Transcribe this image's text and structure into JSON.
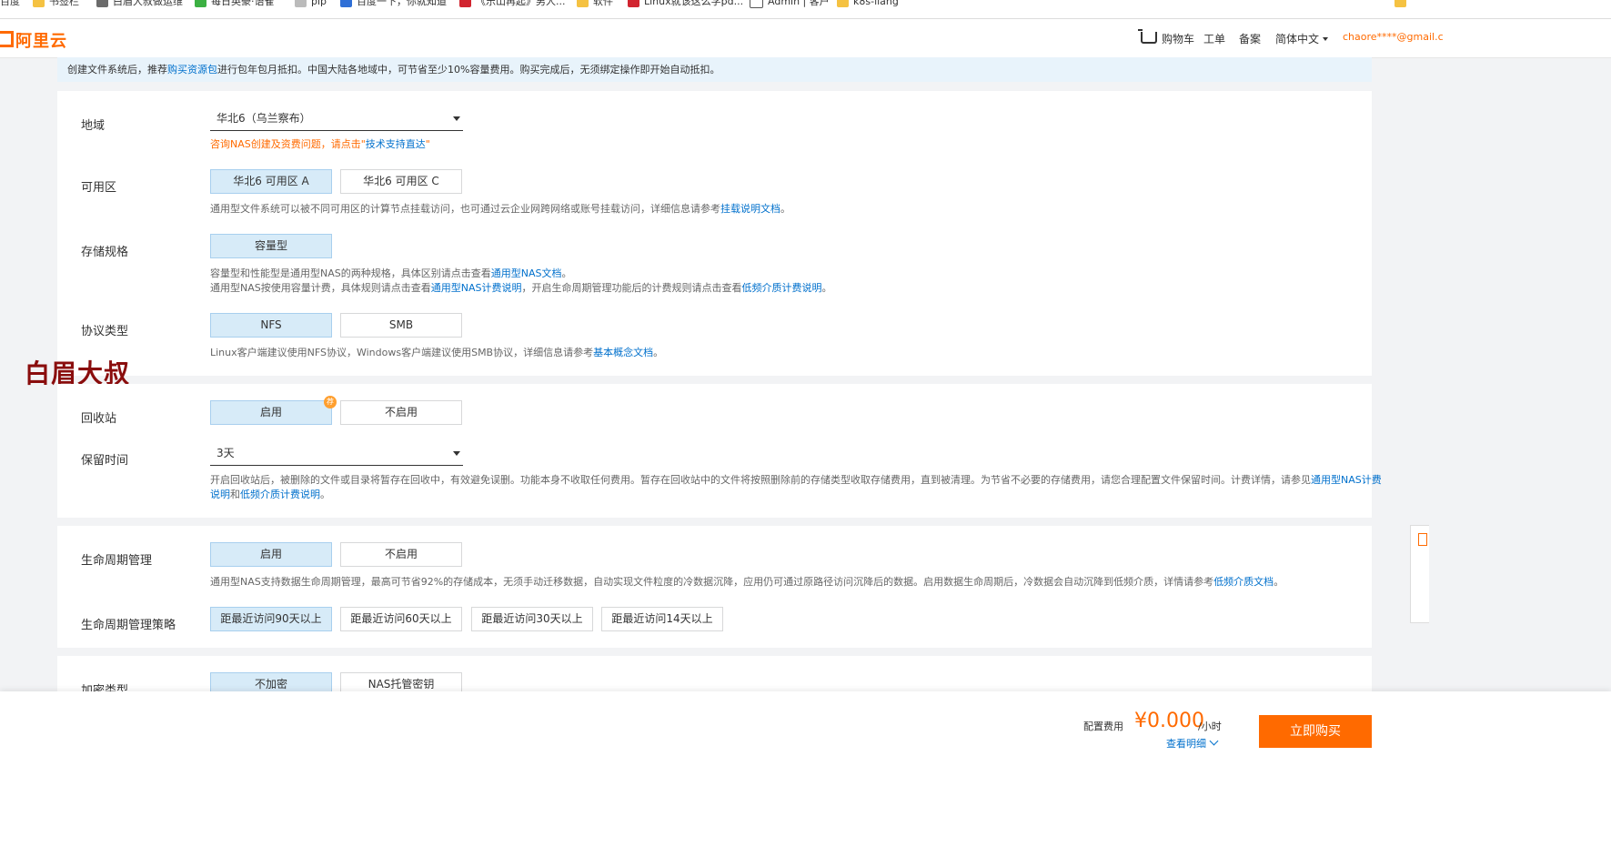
{
  "bookmarks": [
    {
      "label": "百度",
      "icon": "none-icon"
    },
    {
      "label": "书签栏",
      "icon": "folder-icon"
    },
    {
      "label": "白眉大叔做运维",
      "icon": "user-icon"
    },
    {
      "label": "每日英豪·语雀",
      "icon": "leaf-icon"
    },
    {
      "label": "pip",
      "icon": "package-icon"
    },
    {
      "label": "百度一下，你就知道",
      "icon": "paw-icon"
    },
    {
      "label": "《乐山再起》男人...",
      "icon": "video-icon"
    },
    {
      "label": "软件",
      "icon": "folder-icon"
    },
    {
      "label": "Linux就该这么学pd...",
      "icon": "red-icon"
    },
    {
      "label": "Admin | 客户",
      "icon": "doc-icon"
    },
    {
      "label": "k8s-liang",
      "icon": "folder-icon"
    }
  ],
  "header": {
    "logo_text": "阿里云",
    "cart": "购物车",
    "ticket": "工单",
    "record": "备案",
    "language": "简体中文",
    "user": "chaore****@gmail.c"
  },
  "notice": {
    "prefix": "创建文件系统后，推荐",
    "link": "购买资源包",
    "suffix": "进行包年包月抵扣。中国大陆各地域中，可节省至少10%容量费用。购买完成后，无须绑定操作即开始自动抵扣。"
  },
  "region": {
    "label": "地域",
    "value": "华北6（乌兰察布）",
    "hint_prefix": "咨询NAS创建及资费问题，请点击\"",
    "hint_link": "技术支持直达",
    "hint_suffix": "\""
  },
  "zone": {
    "label": "可用区",
    "options": [
      "华北6 可用区 A",
      "华北6 可用区 C"
    ],
    "desc_prefix": "通用型文件系统可以被不同可用区的计算节点挂载访问，也可通过云企业网跨网络或账号挂载访问，详细信息请参考",
    "desc_link": "挂载说明文档",
    "desc_suffix": "。"
  },
  "storage": {
    "label": "存储规格",
    "options": [
      "容量型"
    ],
    "desc1_prefix": "容量型和性能型是通用型NAS的两种规格，具体区别请点击查看",
    "desc1_link": "通用型NAS文档",
    "desc1_suffix": "。",
    "desc2_prefix": "通用型NAS按使用容量计费，具体规则请点击查看",
    "desc2_link1": "通用型NAS计费说明",
    "desc2_mid": "，开启生命周期管理功能后的计费规则请点击查看",
    "desc2_link2": "低频介质计费说明",
    "desc2_suffix": "。"
  },
  "protocol": {
    "label": "协议类型",
    "options": [
      "NFS",
      "SMB"
    ],
    "desc_prefix": "Linux客户端建议使用NFS协议，Windows客户端建议使用SMB协议，详细信息请参考",
    "desc_link": "基本概念文档",
    "desc_suffix": "。"
  },
  "watermark": "白眉大叔",
  "recycle": {
    "label": "回收站",
    "options": [
      "启用",
      "不启用"
    ],
    "badge": "荐"
  },
  "retention": {
    "label": "保留时间",
    "value": "3天",
    "desc_prefix": "开启回收站后，被删除的文件或目录将暂存在回收中，有效避免误删。功能本身不收取任何费用。暂存在回收站中的文件将按照删除前的存储类型收取存储费用，直到被清理。为节省不必要的存储费用，请您合理配置文件保留时间。计费详情，请参见",
    "desc_link1a": "通用型NAS计费",
    "desc_link1b": "说明",
    "desc_mid": "和",
    "desc_link2": "低频介质计费说明",
    "desc_suffix": "。"
  },
  "lifecycle": {
    "label": "生命周期管理",
    "options": [
      "启用",
      "不启用"
    ],
    "desc_prefix": "通用型NAS支持数据生命周期管理，最高可节省92%的存储成本，无须手动迁移数据，自动实现文件粒度的冷数据沉降，应用仍可通过原路径访问沉降后的数据。启用数据生命周期后，冷数据会自动沉降到低频介质，详情请参考",
    "desc_link": "低频介质文档",
    "desc_suffix": "。"
  },
  "lifecycle_policy": {
    "label": "生命周期管理策略",
    "options": [
      "距最近访问90天以上",
      "距最近访问60天以上",
      "距最近访问30天以上",
      "距最近访问14天以上"
    ]
  },
  "encryption": {
    "label": "加密类型",
    "options": [
      "不加密",
      "NAS托管密钥"
    ]
  },
  "footer": {
    "fee_label": "配置费用",
    "fee_value": "¥0.000",
    "fee_unit": "/小时",
    "detail_link": "查看明细",
    "buy_button": "立即购买"
  },
  "colors": {
    "accent": "#ff6a00",
    "link": "#0070cc",
    "selected": "#d7ebf8"
  }
}
